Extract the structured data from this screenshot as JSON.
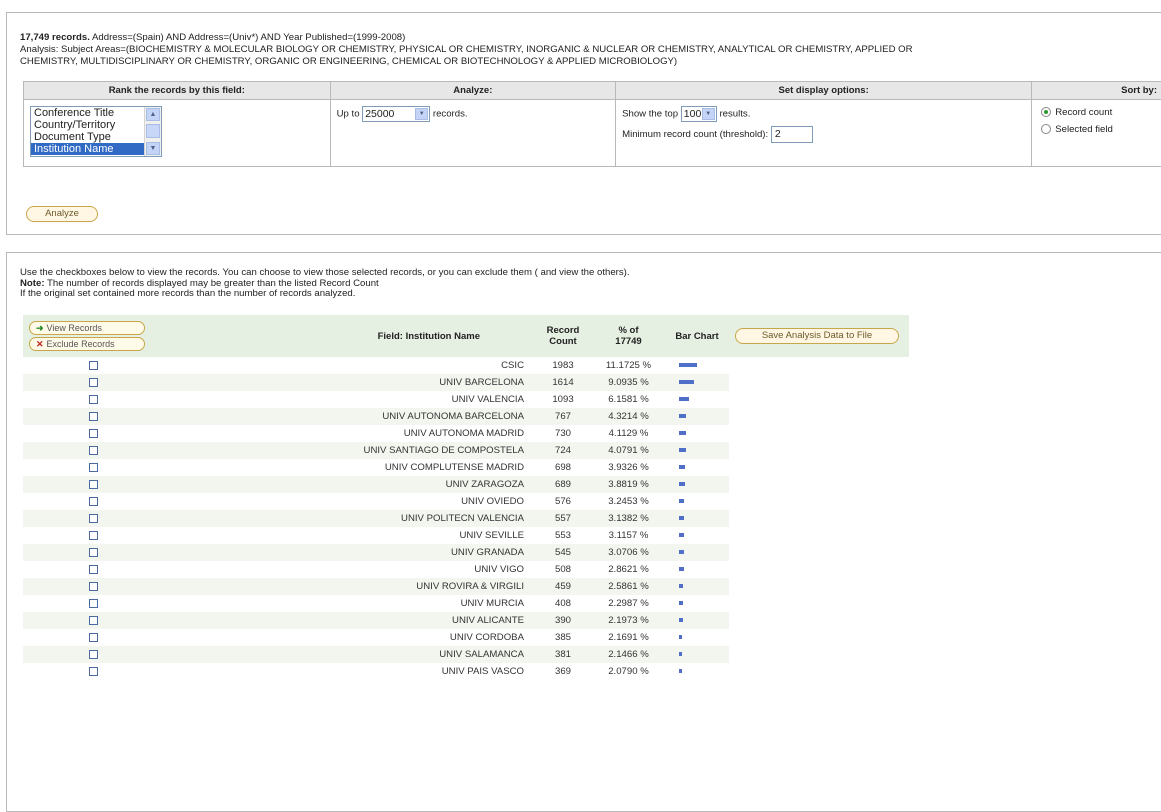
{
  "summary": {
    "count": "17,749 records.",
    "query": " Address=(Spain) AND Address=(Univ*) AND Year Published=(1999-2008)",
    "line2": "Analysis:  Subject Areas=(BIOCHEMISTRY & MOLECULAR BIOLOGY OR CHEMISTRY, PHYSICAL OR CHEMISTRY, INORGANIC & NUCLEAR OR CHEMISTRY, ANALYTICAL OR CHEMISTRY, APPLIED OR",
    "line3": "CHEMISTRY, MULTIDISCIPLINARY OR CHEMISTRY, ORGANIC OR ENGINEERING, CHEMICAL OR BIOTECHNOLOGY & APPLIED MICROBIOLOGY)"
  },
  "options": {
    "rank_header": "Rank the records by this field:",
    "analyze_header": "Analyze:",
    "display_header": "Set display options:",
    "sort_header": "Sort by:",
    "fields": [
      "Conference Title",
      "Country/Territory",
      "Document Type",
      "Institution Name"
    ],
    "up_to": "Up to",
    "up_to_value": "25000",
    "records": "records.",
    "show_top": "Show the top",
    "top_value": "100",
    "results": "results.",
    "min_label": "Minimum record count (threshold):",
    "min_value": "2",
    "sort_record": "Record count",
    "sort_field": "Selected field",
    "analyze_btn": "Analyze"
  },
  "notes": {
    "l1": "Use the checkboxes below to view the records. You can choose to view those selected records, or you can exclude them ( and view the others).",
    "l2_bold": "Note:",
    "l2": " The number of records displayed may be greater than the listed Record Count",
    "l3": "If the original set contained more records than the number of records analyzed."
  },
  "table": {
    "view_btn": "View Records",
    "exclude_btn": "Exclude Records",
    "col_field": "Field: Institution Name",
    "col_count_1": "Record",
    "col_count_2": "Count",
    "col_pct_1": "% of",
    "col_pct_2": "17749",
    "col_bar": "Bar Chart",
    "save_btn": "Save Analysis Data to File",
    "rows": [
      {
        "name": "CSIC",
        "count": "1983",
        "pct": "11.1725 %",
        "share": 0.111725
      },
      {
        "name": "UNIV BARCELONA",
        "count": "1614",
        "pct": "9.0935 %",
        "share": 0.090935
      },
      {
        "name": "UNIV VALENCIA",
        "count": "1093",
        "pct": "6.1581 %",
        "share": 0.061581
      },
      {
        "name": "UNIV AUTONOMA BARCELONA",
        "count": "767",
        "pct": "4.3214 %",
        "share": 0.043214
      },
      {
        "name": "UNIV AUTONOMA MADRID",
        "count": "730",
        "pct": "4.1129 %",
        "share": 0.041129
      },
      {
        "name": "UNIV SANTIAGO DE COMPOSTELA",
        "count": "724",
        "pct": "4.0791 %",
        "share": 0.040791
      },
      {
        "name": "UNIV COMPLUTENSE MADRID",
        "count": "698",
        "pct": "3.9326 %",
        "share": 0.039326
      },
      {
        "name": "UNIV ZARAGOZA",
        "count": "689",
        "pct": "3.8819 %",
        "share": 0.038819
      },
      {
        "name": "UNIV OVIEDO",
        "count": "576",
        "pct": "3.2453 %",
        "share": 0.032453
      },
      {
        "name": "UNIV POLITECN VALENCIA",
        "count": "557",
        "pct": "3.1382 %",
        "share": 0.031382
      },
      {
        "name": "UNIV SEVILLE",
        "count": "553",
        "pct": "3.1157 %",
        "share": 0.031157
      },
      {
        "name": "UNIV GRANADA",
        "count": "545",
        "pct": "3.0706 %",
        "share": 0.030706
      },
      {
        "name": "UNIV VIGO",
        "count": "508",
        "pct": "2.8621 %",
        "share": 0.028621
      },
      {
        "name": "UNIV ROVIRA & VIRGILI",
        "count": "459",
        "pct": "2.5861 %",
        "share": 0.025861
      },
      {
        "name": "UNIV MURCIA",
        "count": "408",
        "pct": "2.2987 %",
        "share": 0.022987
      },
      {
        "name": "UNIV ALICANTE",
        "count": "390",
        "pct": "2.1973 %",
        "share": 0.021973
      },
      {
        "name": "UNIV CORDOBA",
        "count": "385",
        "pct": "2.1691 %",
        "share": 0.021691
      },
      {
        "name": "UNIV SALAMANCA",
        "count": "381",
        "pct": "2.1466 %",
        "share": 0.021466
      },
      {
        "name": "UNIV PAIS VASCO",
        "count": "369",
        "pct": "2.0790 %",
        "share": 0.02079
      }
    ]
  },
  "colors": {
    "bar": "#4f6fc9",
    "header_bg": "#e6f0e2",
    "row_alt": "#f3f6ef"
  }
}
